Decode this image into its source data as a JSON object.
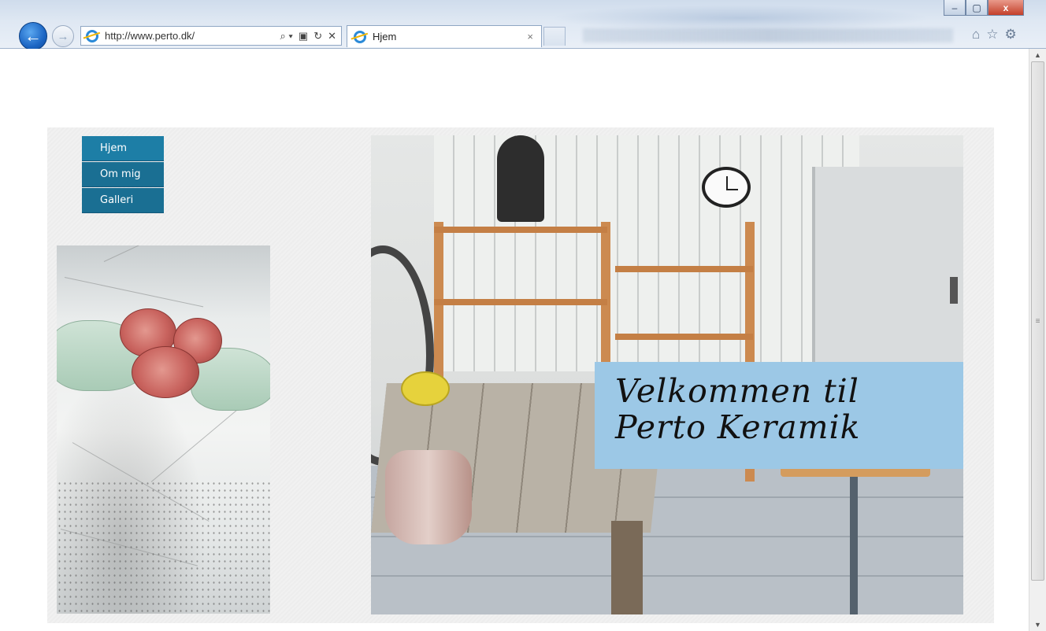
{
  "browser": {
    "address_url": "http://www.perto.dk/",
    "tab_title": "Hjem",
    "tab_close": "×",
    "back_glyph": "←",
    "forward_glyph": "→",
    "address_actions": [
      "⌕ ▾",
      "▣",
      "↻",
      "✕"
    ],
    "window_controls": {
      "minimize": "–",
      "maximize": "▢",
      "close": "x"
    },
    "toolbar_icons": [
      "home-icon",
      "favorites-star-icon",
      "settings-gear-icon"
    ],
    "toolbar_glyphs": {
      "home": "⌂",
      "star": "☆",
      "gear": "⚙"
    },
    "scroll_glyphs": {
      "up": "▲",
      "down": "▼",
      "grip": "≡"
    }
  },
  "site": {
    "nav": [
      {
        "label": "Hjem",
        "active": true
      },
      {
        "label": "Om mig",
        "active": false
      },
      {
        "label": "Galleri",
        "active": false
      }
    ],
    "welcome": {
      "line1": "Velkommen til",
      "line2": "Perto Keramik"
    }
  },
  "colors": {
    "nav_bg": "#1a6f93",
    "welcome_bg": "#9cc8e6",
    "panel_bg": "#efefef"
  }
}
